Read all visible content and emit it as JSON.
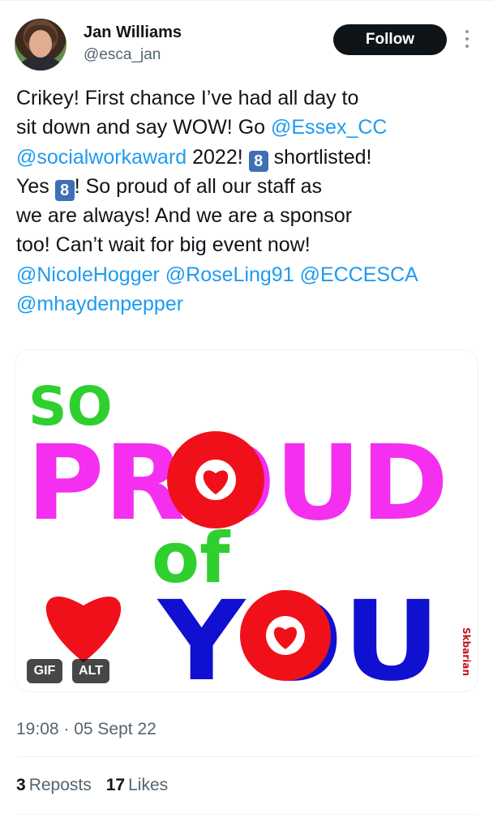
{
  "user": {
    "name": "Jan Williams",
    "handle": "@esca_jan",
    "follow_label": "Follow"
  },
  "tweet": {
    "l1": "Crikey! First chance I’ve had all day to",
    "l2a": "sit down and say WOW! Go ",
    "l2m": "@Essex_CC",
    "l3m": "@socialworkaward",
    "l3a": " 2022! ",
    "keycap": "8",
    "l3b": " shortlisted!",
    "l4a": "Yes ",
    "l4b": "! So proud of all our staff as",
    "l5": "we are always! And we are a sponsor",
    "l6": "too! Can’t wait for big event now!",
    "l7m1": "@NicoleHogger",
    "l7m2": "@RoseLing91",
    "l7m3": "@ECCESCA",
    "l8m": "@mhaydenpepper"
  },
  "media": {
    "line1": "SO",
    "line2": "PROUD",
    "line3": "of",
    "line4": "YOU",
    "credit": "Skbarian",
    "gif_label": "GIF",
    "alt_label": "ALT",
    "colors": {
      "green": "#2fcf2f",
      "magenta": "#f42ff0",
      "red": "#f0101a",
      "blue": "#1010d0"
    }
  },
  "meta": {
    "timestamp": "19:08 · 05 Sept 22",
    "reposts_count": "3",
    "reposts_label": "Reposts",
    "likes_count": "17",
    "likes_label": "Likes"
  }
}
